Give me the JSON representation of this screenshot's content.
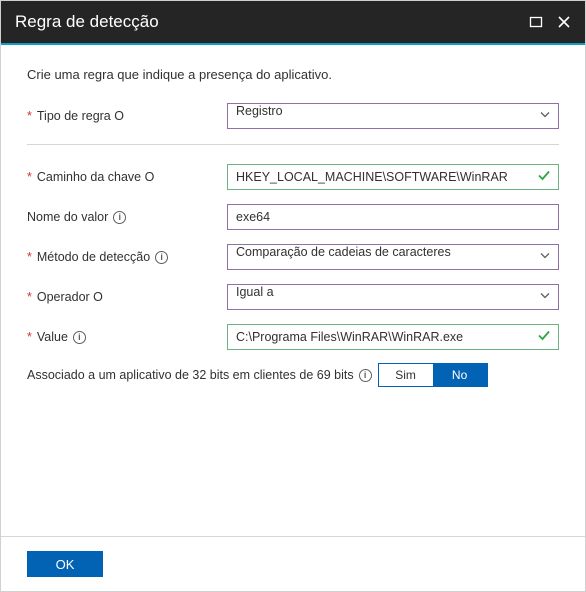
{
  "header": {
    "title": "Regra de detecção"
  },
  "intro": "Crie uma regra que indique a presença do aplicativo.",
  "fields": {
    "ruleType": {
      "label": "Tipo de regra O",
      "value": "Registro"
    },
    "keyPath": {
      "label": "Caminho da chave O",
      "value": "HKEY_LOCAL_MACHINE\\SOFTWARE\\WinRAR"
    },
    "valueName": {
      "label": "Nome do valor",
      "value": "exe64"
    },
    "detectMethod": {
      "label": "Método de detecção",
      "value": "Comparação de cadeias de caracteres"
    },
    "operator": {
      "label": "Operador O",
      "value": "Igual a"
    },
    "value": {
      "label": "Value",
      "value": "C:\\Programa Files\\WinRAR\\WinRAR.exe"
    }
  },
  "toggle": {
    "label": "Associado a um aplicativo de 32 bits em clientes de 69 bits",
    "yes": "Sim",
    "no": "No"
  },
  "footer": {
    "ok": "OK"
  }
}
